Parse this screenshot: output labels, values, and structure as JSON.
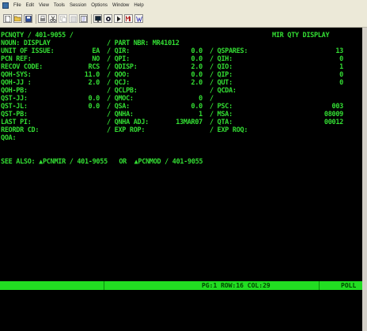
{
  "menu": {
    "items": [
      "File",
      "Edit",
      "View",
      "Tools",
      "Session",
      "Options",
      "Window",
      "Help"
    ]
  },
  "toolbar": {
    "icons": [
      "new-icon",
      "open-icon",
      "save-icon",
      "print-icon",
      "cut-icon",
      "copy-icon",
      "paste-icon",
      "find-icon",
      "screen-icon",
      "record-icon",
      "play-icon",
      "macro-icon",
      "help-icon"
    ]
  },
  "screen": {
    "header_left": "PCNQTY / 401-9055 /",
    "header_right": "MIR QTY DISPLAY",
    "rows": [
      [
        "NOUN: DISPLAY",
        "/ PART NBR: MR41012",
        "",
        ""
      ],
      [
        "UNIT OF ISSUE:",
        "EA",
        "/ QIR:",
        "0.0",
        "/ QSPARES:",
        "13"
      ],
      [
        "PCN REF:",
        "NO",
        "/ QPI:",
        "0.0",
        "/ QIH:",
        "0"
      ],
      [
        "RECOV CODE:",
        "RCS",
        "/ QDISP:",
        "2.0",
        "/ QIO:",
        "1"
      ],
      [
        "QOH-SYS:",
        "11.0",
        "/ QOO:",
        "0.0",
        "/ QIP:",
        "0"
      ],
      [
        "QOH-JJ :",
        "2.0",
        "/ QCJ:",
        "2.0",
        "/ QUT:",
        "0"
      ],
      [
        "QOH-PB:",
        "",
        "/ QCLPB:",
        "",
        "/ QCDA:",
        ""
      ],
      [
        "QST-JJ:",
        "0.0",
        "/ QMOC:",
        "0",
        "/",
        ""
      ],
      [
        "QST-JL:",
        "0.0",
        "/ QSA:",
        "0.0",
        "/ PSC:",
        "003"
      ],
      [
        "QST-PB:",
        "",
        "/ QNHA:",
        "1",
        "/ MSA:",
        "08009"
      ],
      [
        "LAST PI:",
        "",
        "/ QNHA ADJ:",
        "13MAR07",
        "/ QTA:",
        "00012"
      ],
      [
        "REORDR CD:",
        "",
        "/ EXP ROP:",
        "",
        "/ EXP ROQ:",
        ""
      ],
      [
        "QOA:",
        "",
        "",
        "",
        "",
        ""
      ]
    ],
    "see_also": "SEE ALSO: ▲PCNMIR / 401-9055   OR  ▲PCNMOD / 401-9055"
  },
  "status": {
    "position": "PG:1 ROW:16 COL:29",
    "mode": "POLL"
  },
  "colors": {
    "terminal_bg": "#000000",
    "terminal_text": "#33dd33",
    "status_bar": "#22dd22"
  }
}
